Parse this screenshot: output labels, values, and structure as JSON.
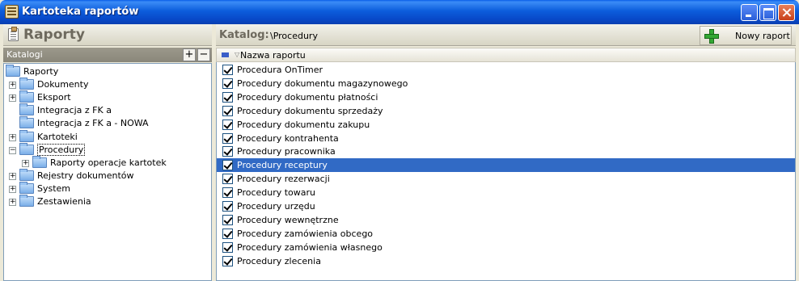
{
  "window": {
    "title": "Kartoteka raportów"
  },
  "left": {
    "title": "Raporty",
    "catalog_label": "Katalogi",
    "add_btn": "+",
    "remove_btn": "−",
    "tree": [
      {
        "label": "Raporty",
        "level": 0,
        "expander": ""
      },
      {
        "label": "Dokumenty",
        "level": 1,
        "expander": "+"
      },
      {
        "label": "Eksport",
        "level": 1,
        "expander": "+"
      },
      {
        "label": "Integracja z FK a",
        "level": 1,
        "expander": ""
      },
      {
        "label": "Integracja z FK a - NOWA",
        "level": 1,
        "expander": ""
      },
      {
        "label": "Kartoteki",
        "level": 1,
        "expander": "+"
      },
      {
        "label": "Procedury",
        "level": 1,
        "expander": "−",
        "selected": true
      },
      {
        "label": "Raporty operacje kartotek",
        "level": 2,
        "expander": "+"
      },
      {
        "label": "Rejestry dokumentów",
        "level": 1,
        "expander": "+"
      },
      {
        "label": "System",
        "level": 1,
        "expander": "+"
      },
      {
        "label": "Zestawienia",
        "level": 1,
        "expander": "+"
      }
    ]
  },
  "right": {
    "catalog_label": "Katalog:",
    "catalog_path": "\\Procedury",
    "new_report_label": "Nowy raport",
    "column_title": "Nazwa raportu",
    "sort_glyph": "▽",
    "rows": [
      {
        "label": "Procedura OnTimer",
        "checked": true
      },
      {
        "label": "Procedury dokumentu magazynowego",
        "checked": true
      },
      {
        "label": "Procedury dokumentu płatności",
        "checked": true
      },
      {
        "label": "Procedury dokumentu sprzedaży",
        "checked": true
      },
      {
        "label": "Procedury dokumentu zakupu",
        "checked": true
      },
      {
        "label": "Procedury kontrahenta",
        "checked": true
      },
      {
        "label": "Procedury pracownika",
        "checked": true
      },
      {
        "label": "Procedury receptury",
        "checked": true,
        "selected": true
      },
      {
        "label": "Procedury rezerwacji",
        "checked": true
      },
      {
        "label": "Procedury towaru",
        "checked": true
      },
      {
        "label": "Procedury urzędu",
        "checked": true
      },
      {
        "label": "Procedury wewnętrzne",
        "checked": true
      },
      {
        "label": "Procedury zamówienia obcego",
        "checked": true
      },
      {
        "label": "Procedury zamówienia własnego",
        "checked": true
      },
      {
        "label": "Procedury zlecenia",
        "checked": true
      }
    ]
  }
}
